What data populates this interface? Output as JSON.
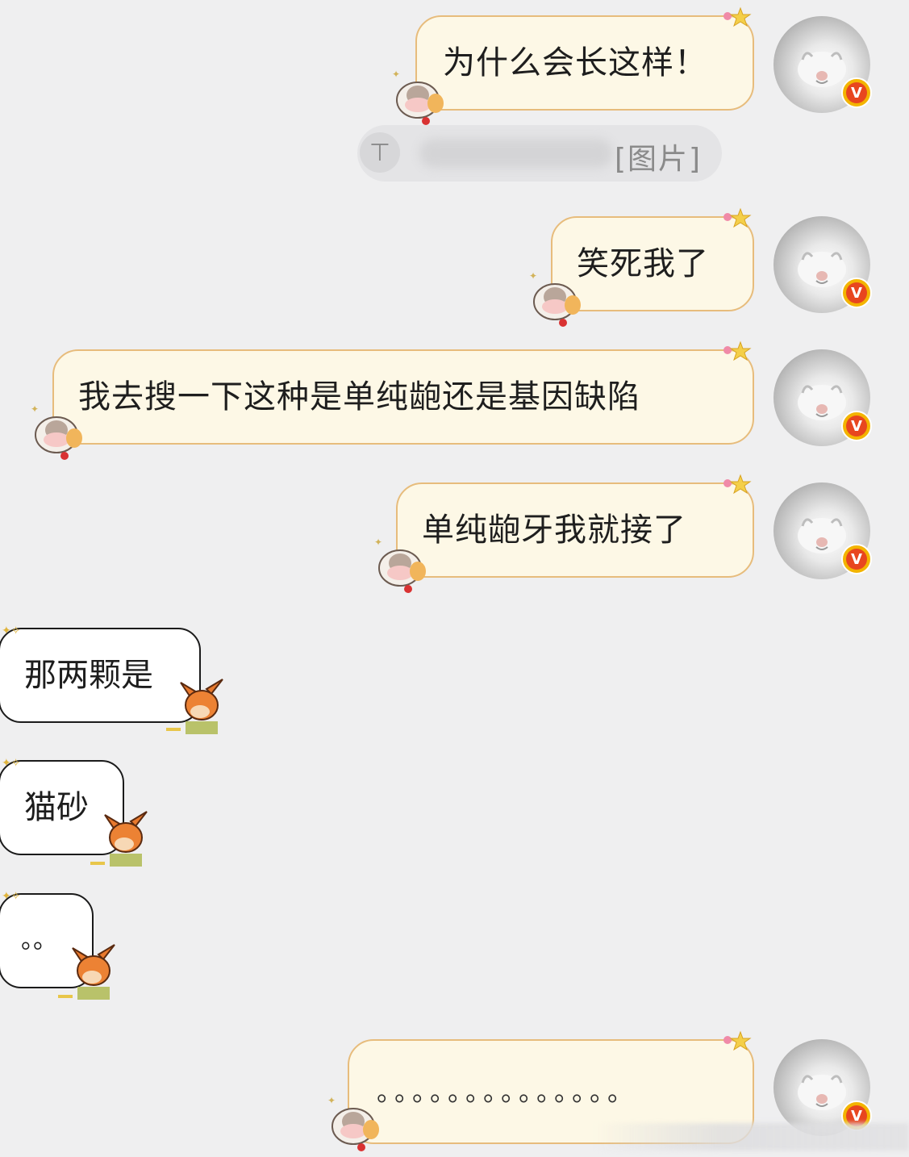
{
  "messages": {
    "m1": "为什么会长这样！",
    "m2": "笑死我了",
    "m3": "我去搜一下这种是单纯龅还是基因缺陷",
    "m4": "单纯龅牙我就接了",
    "m5": "那两颗是",
    "m6": "猫砂",
    "m7": "。。",
    "m8": "。。。。。。。。。。。。。。"
  },
  "quote": {
    "label": "[图片]",
    "icon": "pin-top-icon"
  },
  "avatar": {
    "badge_letter": "V",
    "badge_color": "#e8461f",
    "badge_ring": "#f3b400"
  },
  "colors": {
    "background": "#efeff0",
    "outgoing_bubble": "#fdf8e6",
    "outgoing_border": "#e7bc7c",
    "incoming_bubble": "#ffffff",
    "incoming_border": "#1b1b1b"
  }
}
